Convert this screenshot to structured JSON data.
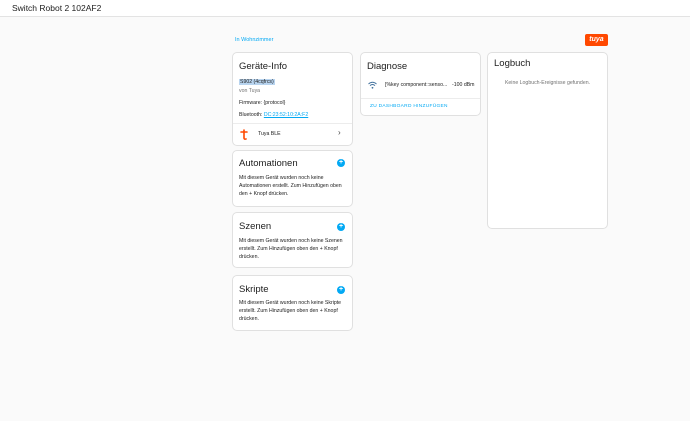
{
  "window": {
    "title": "Switch Robot 2 102AF2"
  },
  "breadcrumb": {
    "area": "In Wohnzimmer"
  },
  "brand": {
    "logo_text": "tuya",
    "color": "#ff4800"
  },
  "device_info": {
    "title": "Geräte-Info",
    "model": "S902 (4cqfrcs)",
    "manufacturer": "von Tuya",
    "firmware": "Firmware: {protocol}",
    "bluetooth_label": "Bluetooth:",
    "bluetooth_address": "DC:23:52:10:2A:F2",
    "integration": "Tuya BLE"
  },
  "diagnose": {
    "title": "Diagnose",
    "entity_name": "[%key component::senso...",
    "entity_value": "-100 dBm",
    "add_to_dashboard": "ZU DASHBOARD HINZUFÜGEN"
  },
  "logbook": {
    "title": "Logbuch",
    "empty": "Keine Logbuch-Ereignisse gefunden."
  },
  "automations": {
    "title": "Automationen",
    "desc": [
      "Mit diesem Gerät wurden noch keine",
      "Automationen erstellt. Zum Hinzufügen oben",
      "den + Knopf drücken."
    ]
  },
  "scenes": {
    "title": "Szenen",
    "desc": [
      "Mit diesem Gerät wurden noch keine Szenen",
      "erstellt. Zum Hinzufügen oben den + Knopf",
      "drücken."
    ]
  },
  "scripts": {
    "title": "Skripte",
    "desc": [
      "Mit diesem Gerät wurden noch keine Skripte",
      "erstellt. Zum Hinzufügen oben den + Knopf",
      "drücken."
    ]
  },
  "colors": {
    "accent": "#03a9f4"
  }
}
